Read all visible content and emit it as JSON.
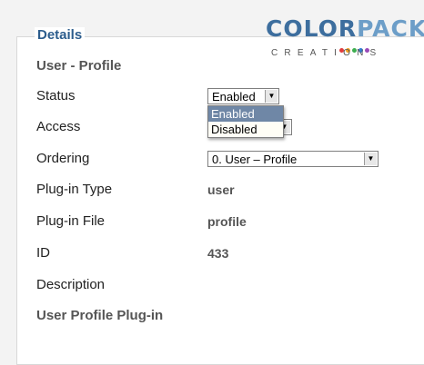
{
  "panel": {
    "legend": "Details",
    "heading": "User - Profile",
    "footer_text": "User Profile Plug-in"
  },
  "logo": {
    "word1": "COLOR",
    "word2": "PACK",
    "sub": "CREATIONS",
    "dot_colors": [
      "#e23b3b",
      "#f0a020",
      "#3cae4f",
      "#2f7fd8",
      "#9a4ab8"
    ]
  },
  "fields": {
    "status": {
      "label": "Status",
      "value": "Enabled",
      "options": [
        "Enabled",
        "Disabled"
      ]
    },
    "access": {
      "label": "Access"
    },
    "ordering": {
      "label": "Ordering",
      "value": "0. User – Profile"
    },
    "plugin_type": {
      "label": "Plug-in Type",
      "value": "user"
    },
    "plugin_file": {
      "label": "Plug-in File",
      "value": "profile"
    },
    "id": {
      "label": "ID",
      "value": "433"
    },
    "description": {
      "label": "Description"
    }
  },
  "colors": {
    "legend": "#2c5d8d",
    "dropdown_highlight": "#6f87a6"
  },
  "icons": {
    "select_arrow": "▼"
  }
}
